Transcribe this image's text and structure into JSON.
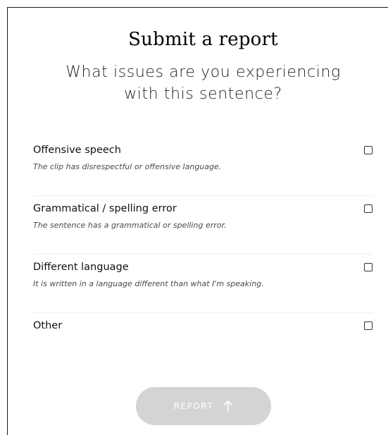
{
  "dialog": {
    "title": "Submit a report",
    "subtitle_line1": "What issues are you experiencing",
    "subtitle_line2": "with this sentence?"
  },
  "options": [
    {
      "label": "Offensive speech",
      "description": "The clip has disrespectful or offensive language.",
      "checked": false
    },
    {
      "label": "Grammatical / spelling error",
      "description": "The sentence has a grammatical or spelling error.",
      "checked": false
    },
    {
      "label": "Different language",
      "description": "It is written in a language different than what I'm speaking.",
      "checked": false
    },
    {
      "label": "Other",
      "description": "",
      "checked": false
    }
  ],
  "report_button": {
    "label": "REPORT",
    "icon": "arrow-up-icon",
    "disabled": true
  },
  "colors": {
    "button_disabled_bg": "#d4d4d4",
    "text": "#111111",
    "description_text": "#4a4a4a"
  }
}
